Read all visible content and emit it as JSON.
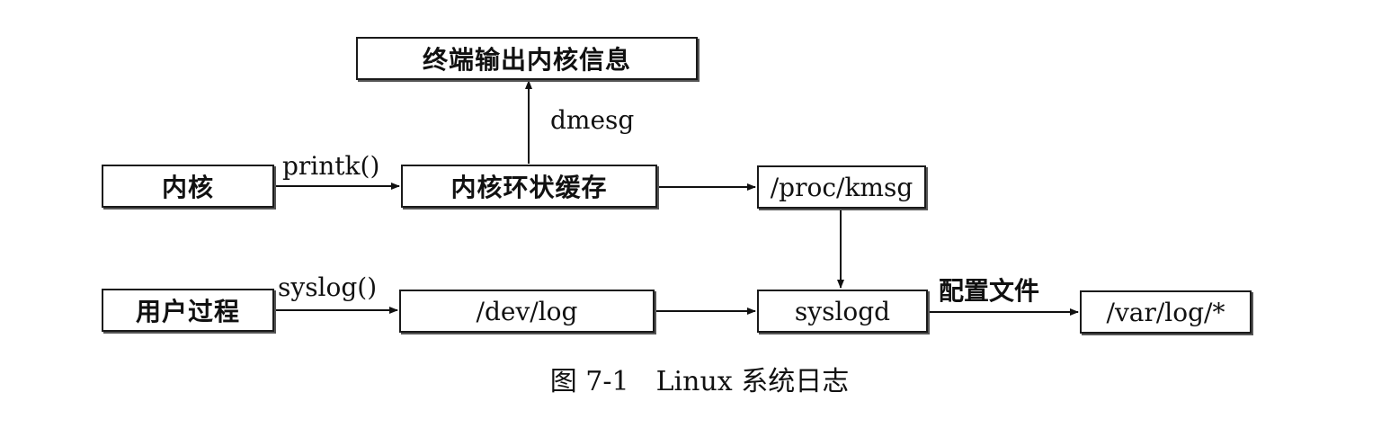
{
  "nodes": {
    "terminal": "终端输出内核信息",
    "kernel": "内核",
    "ring_buffer": "内核环状缓存",
    "proc_kmsg": "/proc/kmsg",
    "user_process": "用户过程",
    "dev_log": "/dev/log",
    "syslogd": "syslogd",
    "var_log": "/var/log/*"
  },
  "edges": {
    "printk": "printk()",
    "dmesg": "dmesg",
    "syslog": "syslog()",
    "config": "配置文件"
  },
  "caption": "图 7-1　Linux 系统日志"
}
